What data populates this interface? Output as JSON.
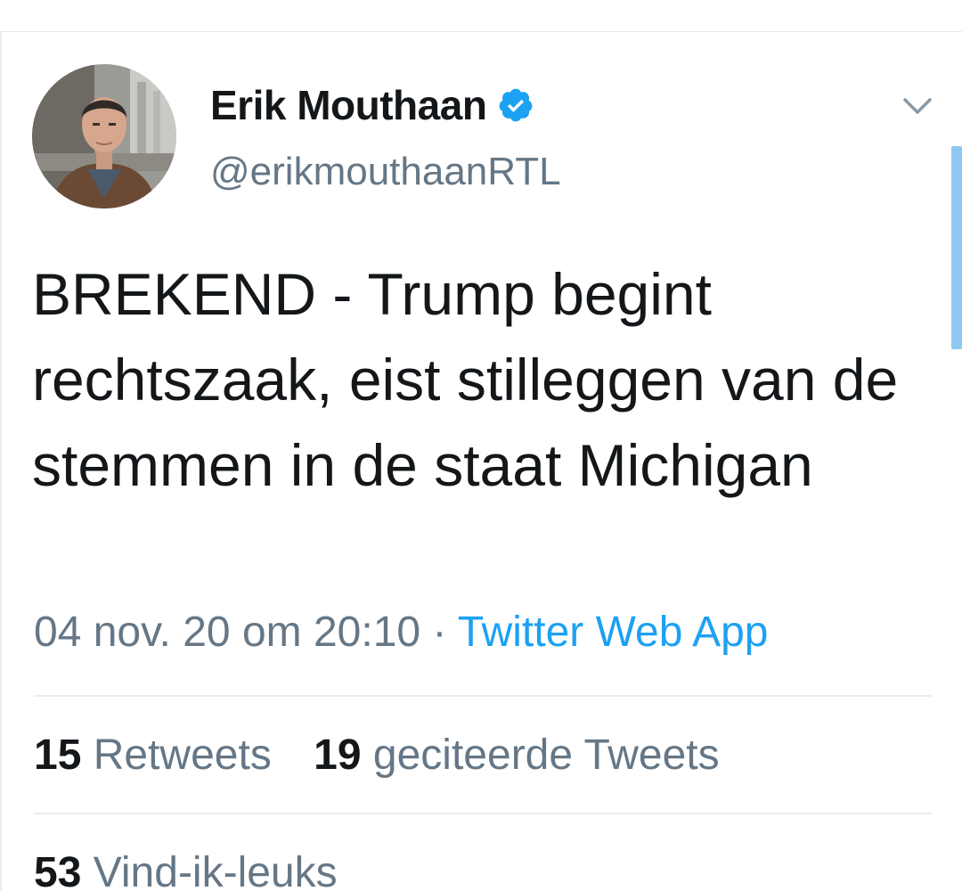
{
  "tweet": {
    "author": {
      "display_name": "Erik Mouthaan",
      "handle": "@erikmouthaanRTL",
      "verified": true
    },
    "text": "BREKEND - Trump begint rechtszaak, eist stilleggen van de stemmen in de staat Michigan",
    "timestamp": "04 nov. 20 om 20:10",
    "separator": "·",
    "source": "Twitter Web App",
    "stats": {
      "retweets": {
        "count": "15",
        "label": "Retweets"
      },
      "quotes": {
        "count": "19",
        "label": "geciteerde Tweets"
      },
      "likes": {
        "count": "53",
        "label": "Vind-ik-leuks"
      }
    }
  },
  "icons": {
    "verified": "verified-badge-icon",
    "menu": "chevron-down-icon"
  },
  "colors": {
    "text_primary": "#14171a",
    "text_secondary": "#657786",
    "accent": "#1da1f2",
    "divider": "#e6ecf0",
    "scrollbar": "#8ec9f0"
  }
}
